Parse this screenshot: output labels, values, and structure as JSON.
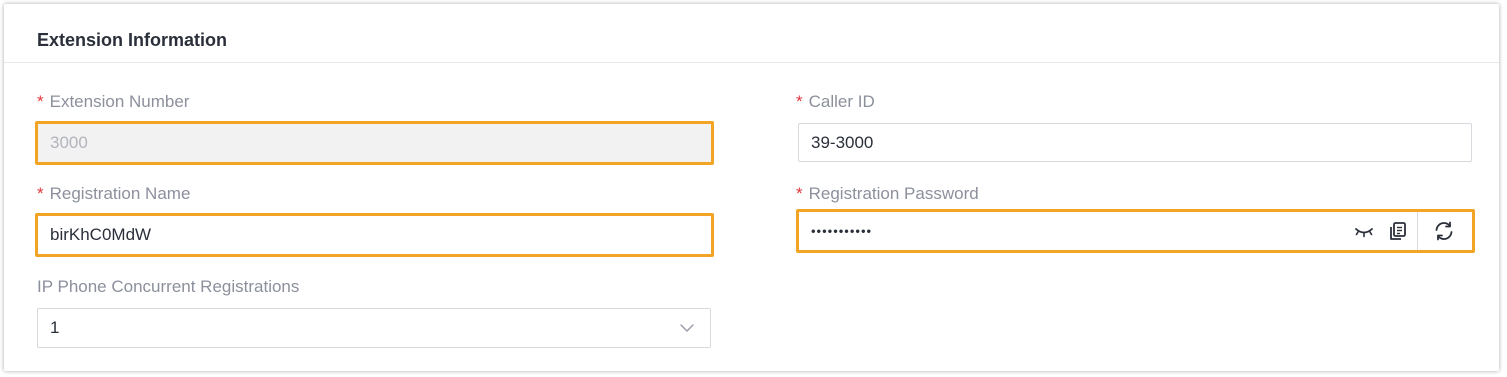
{
  "section": {
    "title": "Extension Information"
  },
  "extension_number": {
    "label": "Extension Number",
    "required": "*",
    "value": "3000"
  },
  "caller_id": {
    "label": "Caller ID",
    "required": "*",
    "value": "39-3000"
  },
  "registration_name": {
    "label": "Registration Name",
    "required": "*",
    "value": "birKhC0MdW"
  },
  "registration_password": {
    "label": "Registration Password",
    "required": "*",
    "value": "•••••••••••",
    "icons": [
      "eye-closed-icon",
      "copy-icon",
      "refresh-icon"
    ]
  },
  "concurrent_registrations": {
    "label": "IP Phone Concurrent Registrations",
    "value": "1"
  },
  "colors": {
    "highlight": "#f2a524",
    "required": "#e0353b",
    "label": "#8c909c"
  }
}
